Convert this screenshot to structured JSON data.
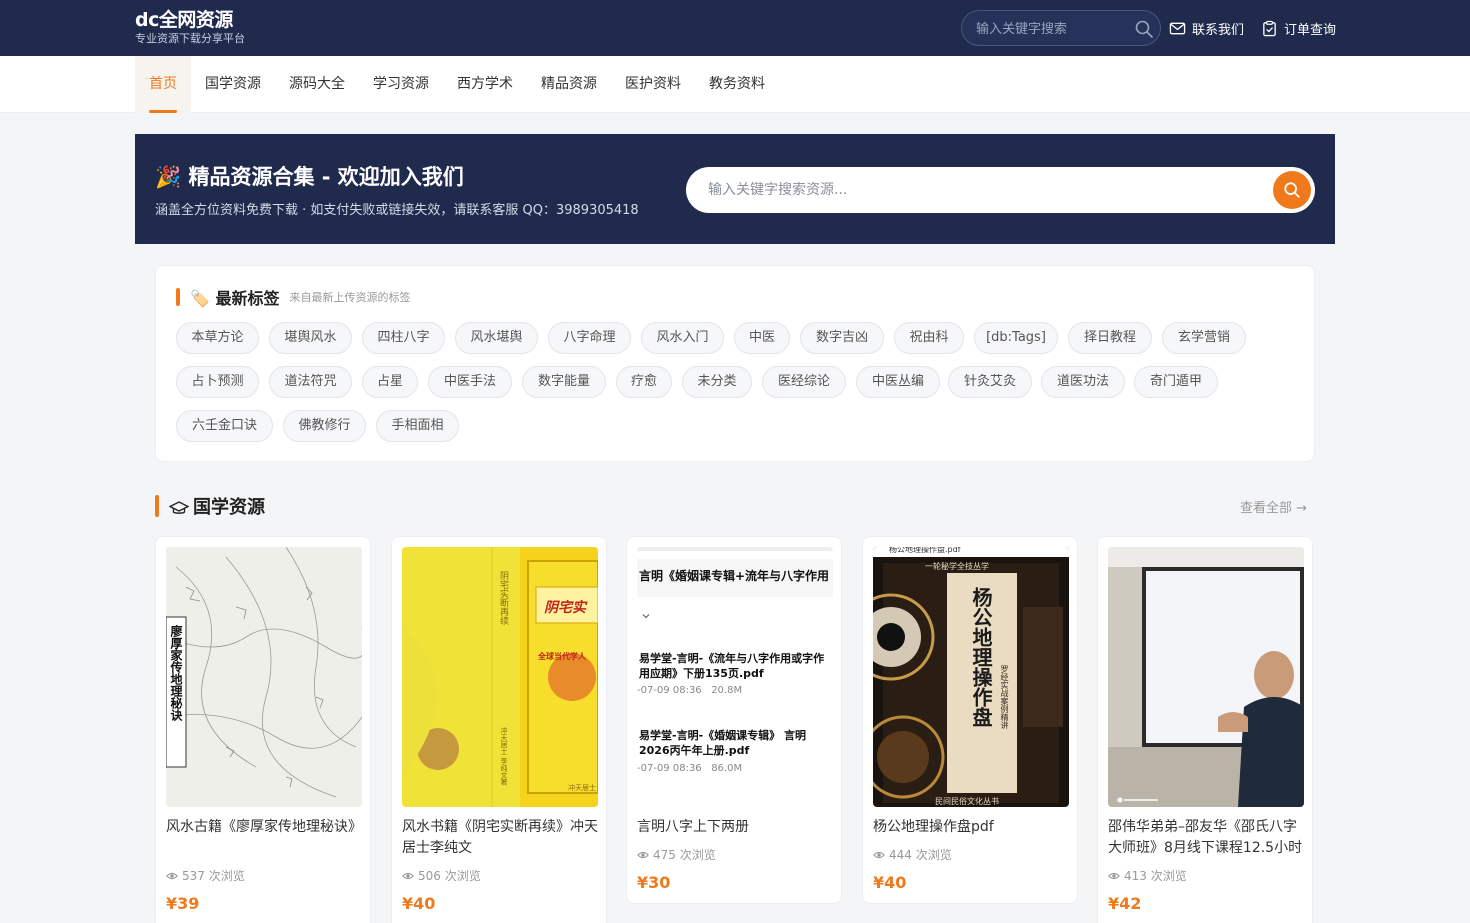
{
  "header": {
    "brand_name": "dc全网资源",
    "brand_sub": "专业资源下载分享平台",
    "search_placeholder": "输入关键字搜索",
    "contact_label": "联系我们",
    "order_label": "订单查询"
  },
  "nav": {
    "items": [
      "首页",
      "国学资源",
      "源码大全",
      "学习资源",
      "西方学术",
      "精品资源",
      "医护资料",
      "教务资料"
    ],
    "active": "首页"
  },
  "banner": {
    "title": "🎉 精品资源合集 - 欢迎加入我们",
    "subtitle": "涵盖全方位资料免费下载 · 如支付失败或链接失效，请联系客服 QQ：3989305418",
    "search_placeholder": "输入关键字搜索资源..."
  },
  "tags_section": {
    "title": "🏷️ 最新标签",
    "subtitle": "来自最新上传资源的标签",
    "tags": [
      "本草方论",
      "堪舆风水",
      "四柱八字",
      "风水堪舆",
      "八字命理",
      "风水入门",
      "中医",
      "数字吉凶",
      "祝由科",
      "[db:Tags]",
      "择日教程",
      "玄学营销",
      "占卜预测",
      "道法符咒",
      "占星",
      "中医手法",
      "数字能量",
      "疗愈",
      "未分类",
      "医经综论",
      "中医丛编",
      "针灸艾灸",
      "道医功法",
      "奇门遁甲",
      "六壬金口诀",
      "佛教修行",
      "手相面相"
    ]
  },
  "guoxue_section": {
    "title": "国学资源",
    "view_all": "查看全部 →",
    "cards": [
      {
        "title": "风水古籍《廖厚家传地理秘诀》",
        "views": "537 次浏览",
        "price": "¥39",
        "thumb_text": "廖厚家传地理秘诀"
      },
      {
        "title": "风水书籍《阴宅实断再续》冲天居士李纯文",
        "views": "506 次浏览",
        "price": "¥40",
        "thumb_text": "阴宅实",
        "thumb_side": "阴宅实断再续",
        "thumb_band": "全球当代学人",
        "thumb_foot": "冲天居士 李纯文著",
        "thumb_corner": "冲天居士"
      },
      {
        "title": "言明八字上下两册",
        "views": "475 次浏览",
        "price": "¥30",
        "thumb_header": "言明《婚姻课专辑+流年与八字作用",
        "thumb_file1": "易学堂-言明-《流年与八字作用或字作用应期》下册135页.pdf",
        "thumb_meta1": "-07-09 08:36   20.8M",
        "thumb_file2": "易学堂-言明-《婚姻课专辑》 言明 2026丙午年上册.pdf",
        "thumb_meta2": "-07-09 08:36   86.0M"
      },
      {
        "title": "杨公地理操作盘pdf",
        "views": "444 次浏览",
        "price": "¥40",
        "thumb_bar": "杨公地理操作盘.pdf",
        "thumb_top": "一轮秘学全技丛学",
        "thumb_text": "杨公地理操作盘",
        "thumb_left": "透析罗经法 古法真经 秘传秘笈",
        "thumb_right": "罗经实战案例精讲",
        "thumb_foot": "民间民俗文化丛书"
      },
      {
        "title": "邵伟华弟弟–邵友华《邵氏八字大师班》8月线下课程12.5小时",
        "views": "413 次浏览",
        "price": "¥42"
      }
    ]
  },
  "colors": {
    "header_bg": "#1f2a4d",
    "accent": "#f07a1b",
    "page_bg": "#f4f5f7"
  }
}
